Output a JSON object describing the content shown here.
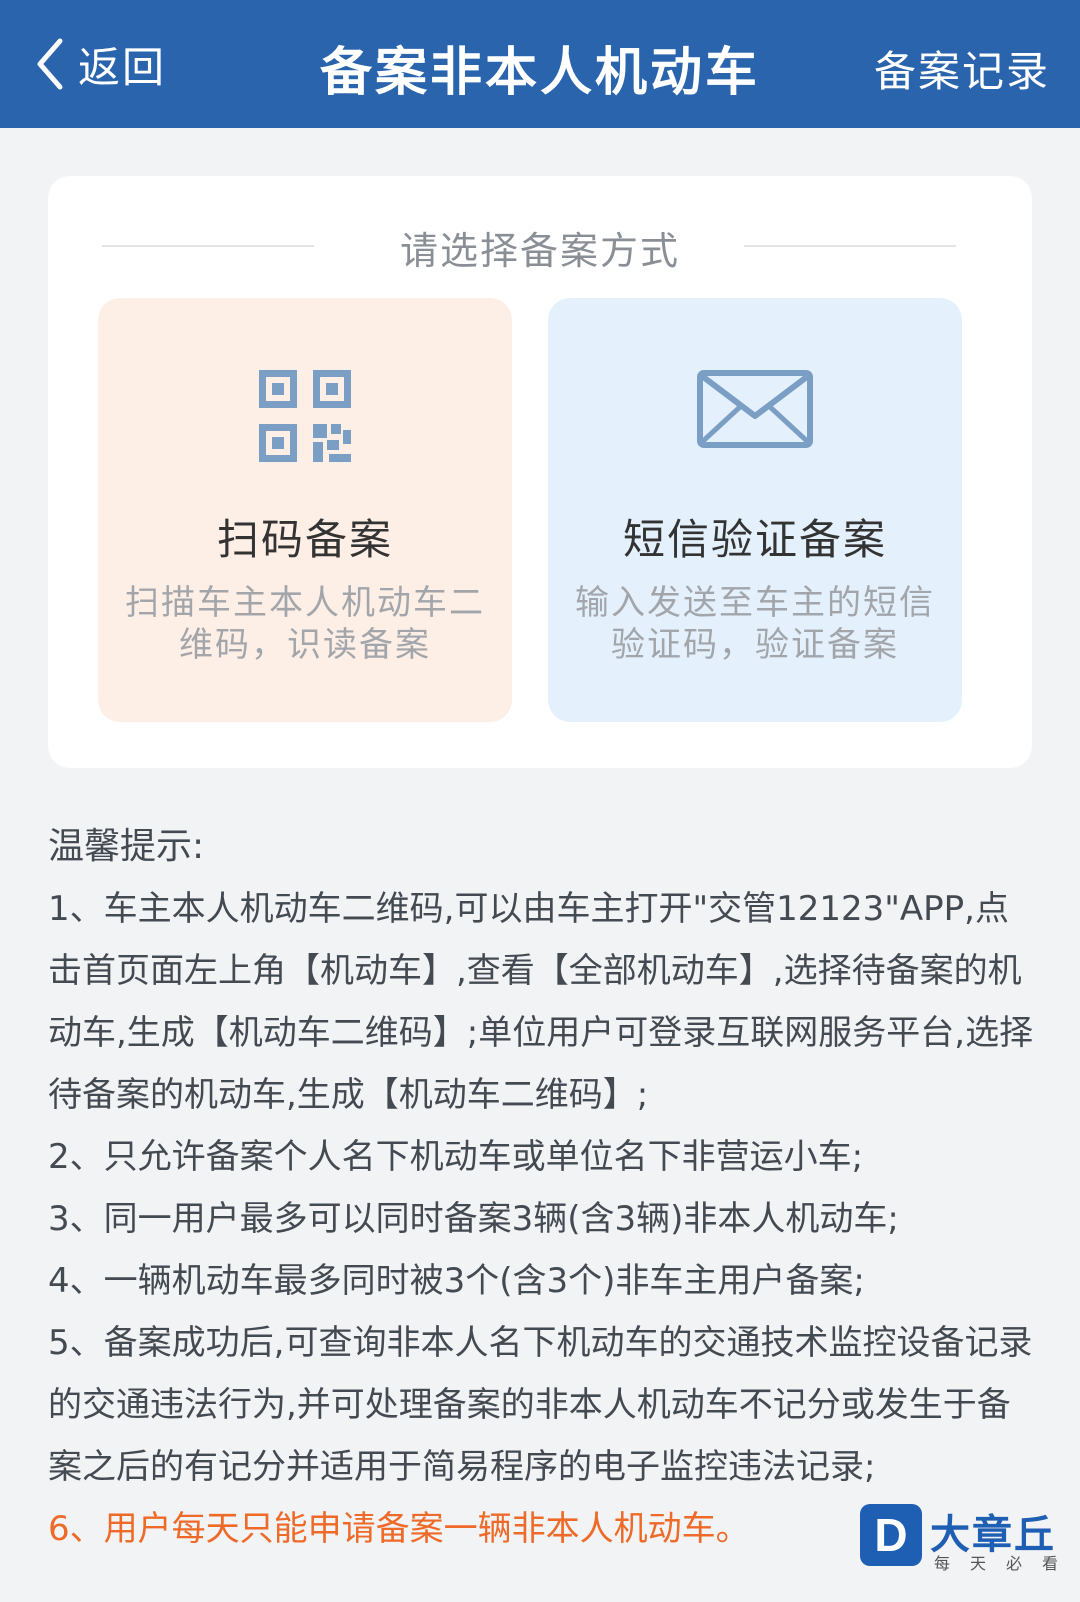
{
  "header": {
    "back_label": "返回",
    "title": "备案非本人机动车",
    "records_label": "备案记录",
    "background_color": "#2a64ad"
  },
  "selection": {
    "prompt": "请选择备案方式",
    "options": [
      {
        "title": "扫码备案",
        "description": "扫描车主本人机动车二维码，识读备案",
        "icon": "qr-code-icon",
        "background_color": "#fdeee6"
      },
      {
        "title": "短信验证备案",
        "description": "输入发送至车主的短信验证码，验证备案",
        "icon": "envelope-icon",
        "background_color": "#e4f1fc"
      }
    ]
  },
  "tips": {
    "title": "温馨提示:",
    "items": [
      "1、车主本人机动车二维码,可以由车主打开\"交管12123\"APP,点击首页面左上角【机动车】,查看【全部机动车】,选择待备案的机动车,生成【机动车二维码】;单位用户可登录互联网服务平台,选择待备案的机动车,生成【机动车二维码】;",
      "2、只允许备案个人名下机动车或单位名下非营运小车;",
      "3、同一用户最多可以同时备案3辆(含3辆)非本人机动车;",
      "4、一辆机动车最多同时被3个(含3个)非车主用户备案;",
      "5、备案成功后,可查询非本人名下机动车的交通技术监控设备记录的交通违法行为,并可处理备案的非本人机动车不记分或发生于备案之后的有记分并适用于简易程序的电子监控违法记录;",
      "6、用户每天只能申请备案一辆非本人机动车。"
    ],
    "highlight_color": "#ee6a28"
  },
  "watermark": {
    "badge": "D",
    "name": "大章丘",
    "slogan": "每天必看"
  }
}
